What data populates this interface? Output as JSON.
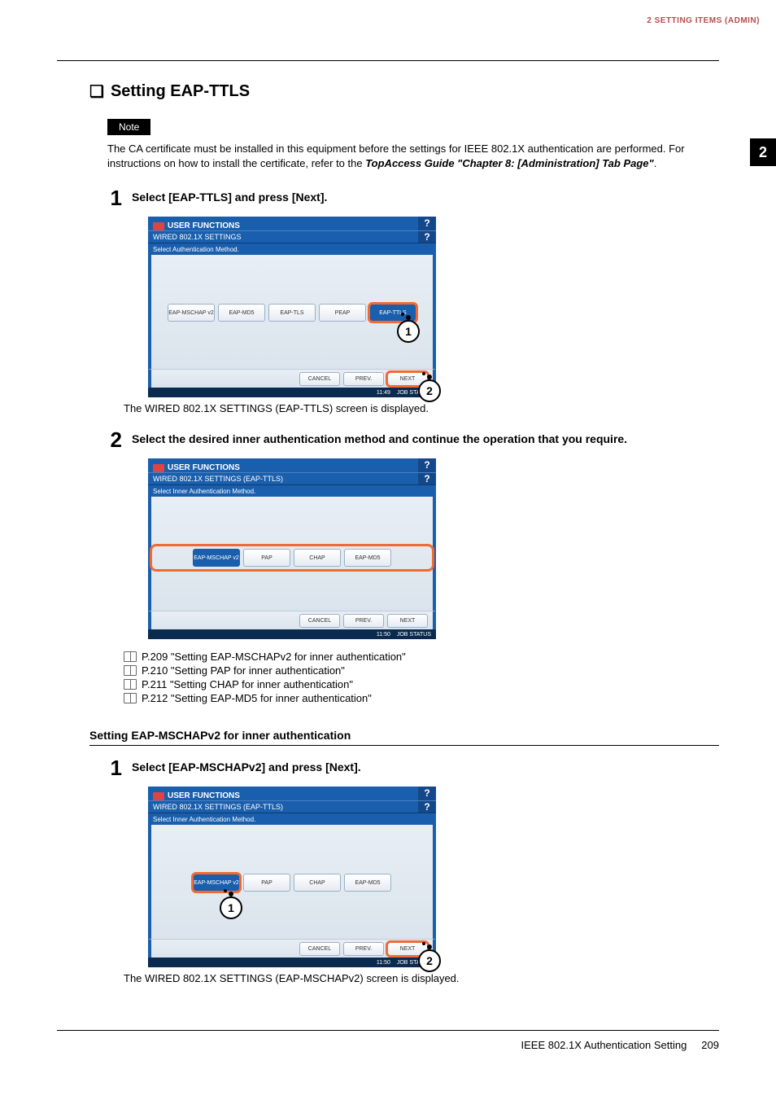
{
  "header": {
    "breadcrumb": "2 SETTING ITEMS (ADMIN)",
    "side_tab": "2"
  },
  "section": {
    "title": "Setting EAP-TTLS",
    "note_label": "Note",
    "note_body_1": "The CA certificate must be installed in this equipment before the settings for IEEE 802.1X authentication are performed. For instructions on how to install the certificate, refer to the ",
    "note_body_em": "TopAccess Guide \"Chapter 8: [Administration] Tab Page\"",
    "note_body_2": "."
  },
  "step1": {
    "num": "1",
    "text": "Select [EAP-TTLS] and press [Next].",
    "after": "The WIRED 802.1X SETTINGS (EAP-TTLS) screen is displayed.",
    "screen": {
      "title": "USER FUNCTIONS",
      "subtitle": "WIRED 802.1X SETTINGS",
      "instruction": "Select Authentication Method.",
      "buttons": [
        "EAP-MSCHAP v2",
        "EAP-MD5",
        "EAP-TLS",
        "PEAP",
        "EAP-TTLS"
      ],
      "footer": [
        "CANCEL",
        "PREV.",
        "NEXT"
      ],
      "time": "11:49",
      "status": "JOB STATUS",
      "callouts": [
        "1",
        "2"
      ]
    }
  },
  "step2": {
    "num": "2",
    "text": "Select the desired inner authentication method and continue the operation that you require.",
    "screen": {
      "title": "USER FUNCTIONS",
      "subtitle": "WIRED 802.1X SETTINGS (EAP-TTLS)",
      "instruction": "Select Inner Authentication Method.",
      "buttons": [
        "EAP-MSCHAP v2",
        "PAP",
        "CHAP",
        "EAP-MD5"
      ],
      "footer": [
        "CANCEL",
        "PREV.",
        "NEXT"
      ],
      "time": "11:50",
      "status": "JOB STATUS"
    },
    "refs": [
      "P.209 \"Setting EAP-MSCHAPv2 for inner authentication\"",
      "P.210 \"Setting PAP for inner authentication\"",
      "P.211 \"Setting CHAP for inner authentication\"",
      "P.212 \"Setting EAP-MD5 for inner authentication\""
    ]
  },
  "subsection": {
    "heading": "Setting EAP-MSCHAPv2 for inner authentication",
    "step1": {
      "num": "1",
      "text": "Select [EAP-MSCHAPv2] and press [Next].",
      "after": "The WIRED 802.1X SETTINGS (EAP-MSCHAPv2) screen is displayed.",
      "screen": {
        "title": "USER FUNCTIONS",
        "subtitle": "WIRED 802.1X SETTINGS (EAP-TTLS)",
        "instruction": "Select Inner Authentication Method.",
        "buttons": [
          "EAP-MSCHAP v2",
          "PAP",
          "CHAP",
          "EAP-MD5"
        ],
        "footer": [
          "CANCEL",
          "PREV.",
          "NEXT"
        ],
        "time": "11:50",
        "status": "JOB STATUS",
        "callouts": [
          "1",
          "2"
        ]
      }
    }
  },
  "footer": {
    "label": "IEEE 802.1X Authentication Setting",
    "page": "209"
  }
}
